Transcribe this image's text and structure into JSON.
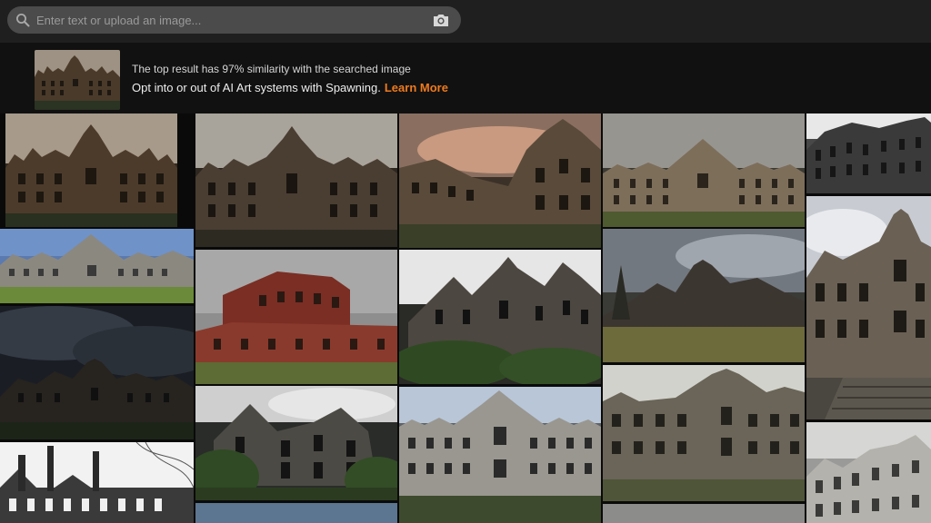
{
  "search": {
    "placeholder": "Enter text or upload an image...",
    "icon": "search-icon",
    "camera_icon": "camera-icon"
  },
  "summary": {
    "similarity_text": "The top result has 97% similarity with the searched image",
    "spawning_text": "Opt into or out of AI Art systems with Spawning.",
    "learn_more": "Learn More"
  },
  "colors": {
    "topbar": "#1f1f1f",
    "search_bg": "#4b4b4b",
    "accent": "#f07a1d"
  }
}
